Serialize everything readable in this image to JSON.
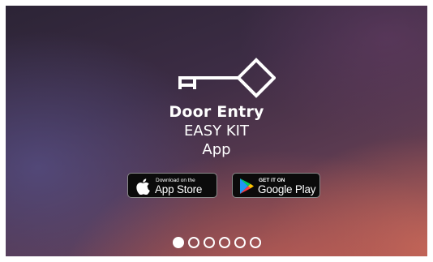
{
  "colors": {
    "accent": "#ffffff",
    "badge_bg": "#0b0b0b",
    "badge_border": "#8a8a8a"
  },
  "hero": {
    "icon": "key-icon",
    "title_line1": "Door Entry",
    "title_line2": "EASY KIT",
    "title_line3": "App"
  },
  "badges": {
    "app_store": {
      "icon": "apple-icon",
      "small": "Download on the",
      "big": "App Store"
    },
    "google_play": {
      "icon": "google-play-icon",
      "small": "GET IT ON",
      "big": "Google Play"
    }
  },
  "pagination": {
    "total": 6,
    "active": 1
  }
}
